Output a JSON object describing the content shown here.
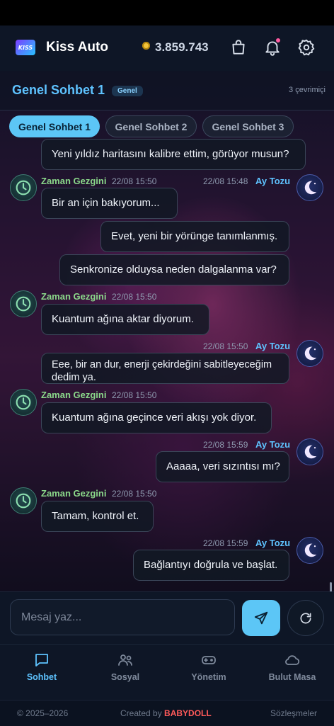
{
  "app": {
    "title": "Kiss Auto",
    "logo_text": "KISS",
    "balance": "3.859.743"
  },
  "chat": {
    "title": "Genel Sohbet 1",
    "badge": "Genel",
    "online": "3 çevrimiçi"
  },
  "tabs": [
    {
      "label": "Genel Sohbet 1",
      "active": true
    },
    {
      "label": "Genel Sohbet 2",
      "active": false
    },
    {
      "label": "Genel Sohbet 3",
      "active": false
    }
  ],
  "messages": [
    {
      "side": "right",
      "text": "Yeni yıldız haritasını kalibre ettim, görüyor musun?"
    },
    {
      "side": "left",
      "user": "Zaman Gezgini",
      "time": "22/08 15:50",
      "text": "Bir an için bakıyorum..."
    },
    {
      "side": "right",
      "user": "Ay Tozu",
      "time": "22/08 15:48",
      "text": "Evet, yeni bir yörünge tanımlanmış."
    },
    {
      "side": "right",
      "text": "Senkronize olduysa neden dalgalanma var?"
    },
    {
      "side": "left",
      "user": "Zaman Gezgini",
      "time": "22/08 15:50",
      "text": "Kuantum ağına aktar diyorum."
    },
    {
      "side": "right",
      "user": "Ay Tozu",
      "time": "22/08 15:50",
      "text": "Eee, bir an dur, enerji çekirdeğini sabitleyeceğim dedim ya."
    },
    {
      "side": "left",
      "user": "Zaman Gezgini",
      "time": "22/08 15:50",
      "text": "Kuantum ağına geçince veri akışı yok diyor."
    },
    {
      "side": "right",
      "user": "Ay Tozu",
      "time": "22/08 15:59",
      "text": "Aaaaa, veri sızıntısı mı?"
    },
    {
      "side": "left",
      "user": "Zaman Gezgini",
      "time": "22/08 15:50",
      "text": "Tamam, kontrol et."
    },
    {
      "side": "right",
      "user": "Ay Tozu",
      "time": "22/08 15:59",
      "text": "Bağlantıyı doğrula ve başlat."
    }
  ],
  "composer": {
    "placeholder": "Mesaj yaz..."
  },
  "nav": [
    {
      "label": "Sohbet",
      "icon": "chat-icon",
      "active": true
    },
    {
      "label": "Sosyal",
      "icon": "users-icon",
      "active": false
    },
    {
      "label": "Yönetim",
      "icon": "gamepad-icon",
      "active": false
    },
    {
      "label": "Bulut Masa",
      "icon": "cloud-icon",
      "active": false
    }
  ],
  "footer": {
    "copyright": "© 2025–2026",
    "created_by": "Created by",
    "brand": "BABYDOLL",
    "terms": "Sözleşmeler"
  },
  "colors": {
    "accent": "#5cc6f6",
    "left_user": "#8bd88a",
    "right_user": "#5ec3ff",
    "brand": "#ff5a5a"
  }
}
